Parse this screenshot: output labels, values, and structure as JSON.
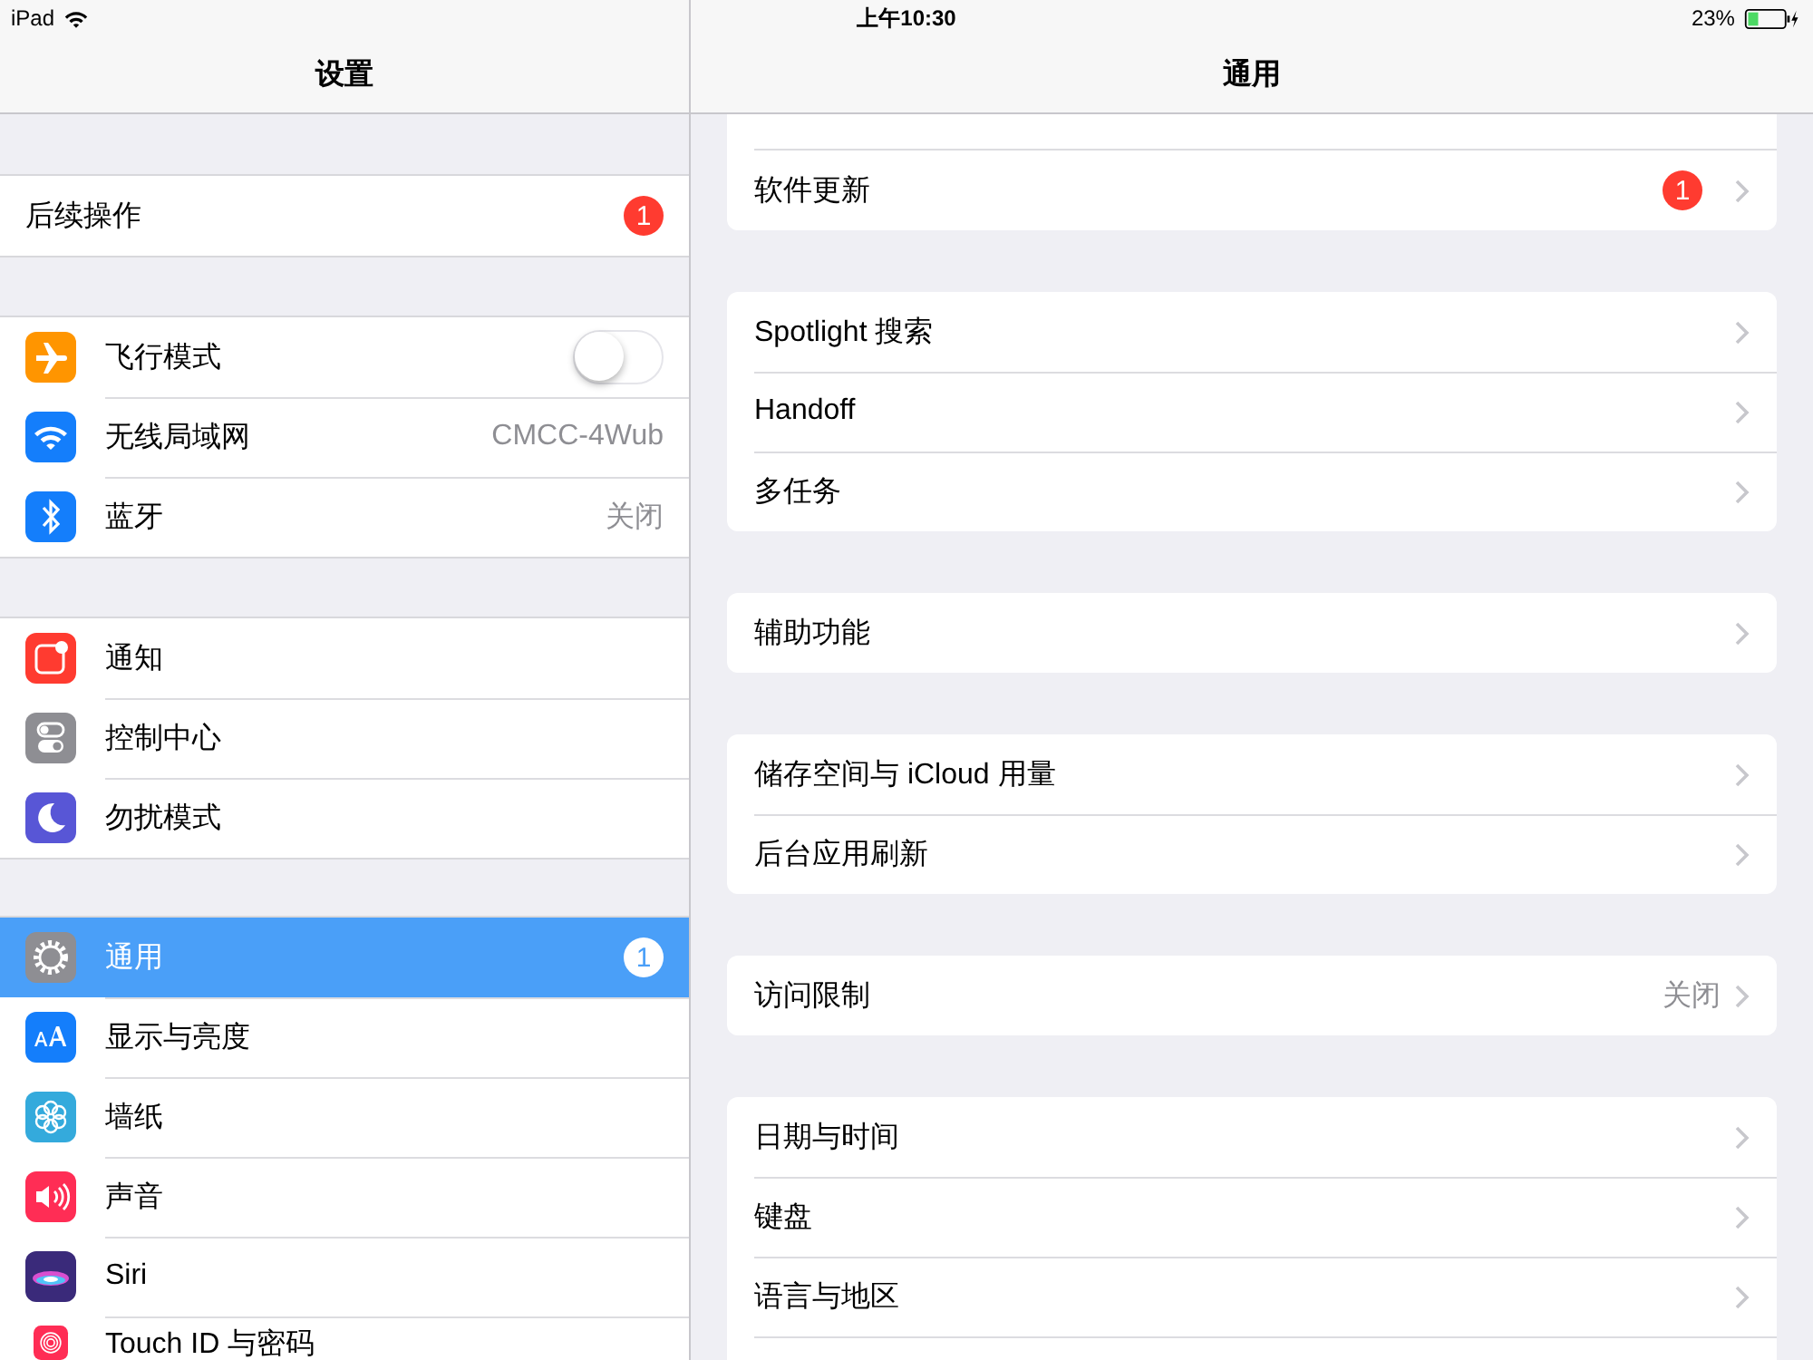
{
  "status_bar": {
    "device": "iPad",
    "time": "上午10:30",
    "battery": "23%"
  },
  "sidebar": {
    "title": "设置",
    "groups": [
      {
        "items": [
          {
            "label": "后续操作",
            "badge": "1",
            "selected": false
          }
        ]
      },
      {
        "items": [
          {
            "label": "飞行模式",
            "kind": "airplane",
            "on": false,
            "selected": false
          },
          {
            "label": "无线局域网",
            "kind": "wifi",
            "value": "CMCC-4Wub",
            "selected": false
          },
          {
            "label": "蓝牙",
            "kind": "bluetooth",
            "value": "关闭",
            "selected": false
          }
        ]
      },
      {
        "items": [
          {
            "label": "通知",
            "kind": "notifications",
            "selected": false
          },
          {
            "label": "控制中心",
            "kind": "control",
            "selected": false
          },
          {
            "label": "勿扰模式",
            "kind": "moon",
            "selected": false
          }
        ]
      },
      {
        "items": [
          {
            "label": "通用",
            "kind": "gear",
            "badge": "1",
            "selected": true
          },
          {
            "label": "显示与亮度",
            "kind": "display",
            "selected": false
          },
          {
            "label": "墙纸",
            "kind": "flower",
            "selected": false
          },
          {
            "label": "声音",
            "kind": "sound",
            "selected": false
          },
          {
            "label": "Siri",
            "kind": "siri",
            "selected": false
          },
          {
            "label": "Touch ID 与密码",
            "kind": "fingerprint",
            "selected": false
          }
        ]
      }
    ]
  },
  "detail": {
    "title": "通用",
    "groups": [
      {
        "items": [
          {
            "label": "软件更新",
            "badge": "1"
          }
        ]
      },
      {
        "items": [
          {
            "label": "Spotlight 搜索"
          },
          {
            "label": "Handoff"
          },
          {
            "label": "多任务"
          }
        ]
      },
      {
        "items": [
          {
            "label": "辅助功能"
          }
        ]
      },
      {
        "items": [
          {
            "label": "储存空间与 iCloud 用量"
          },
          {
            "label": "后台应用刷新"
          }
        ]
      },
      {
        "items": [
          {
            "label": "访问限制",
            "value": "关闭"
          }
        ]
      },
      {
        "items": [
          {
            "label": "日期与时间"
          },
          {
            "label": "键盘"
          },
          {
            "label": "语言与地区"
          }
        ]
      }
    ]
  }
}
